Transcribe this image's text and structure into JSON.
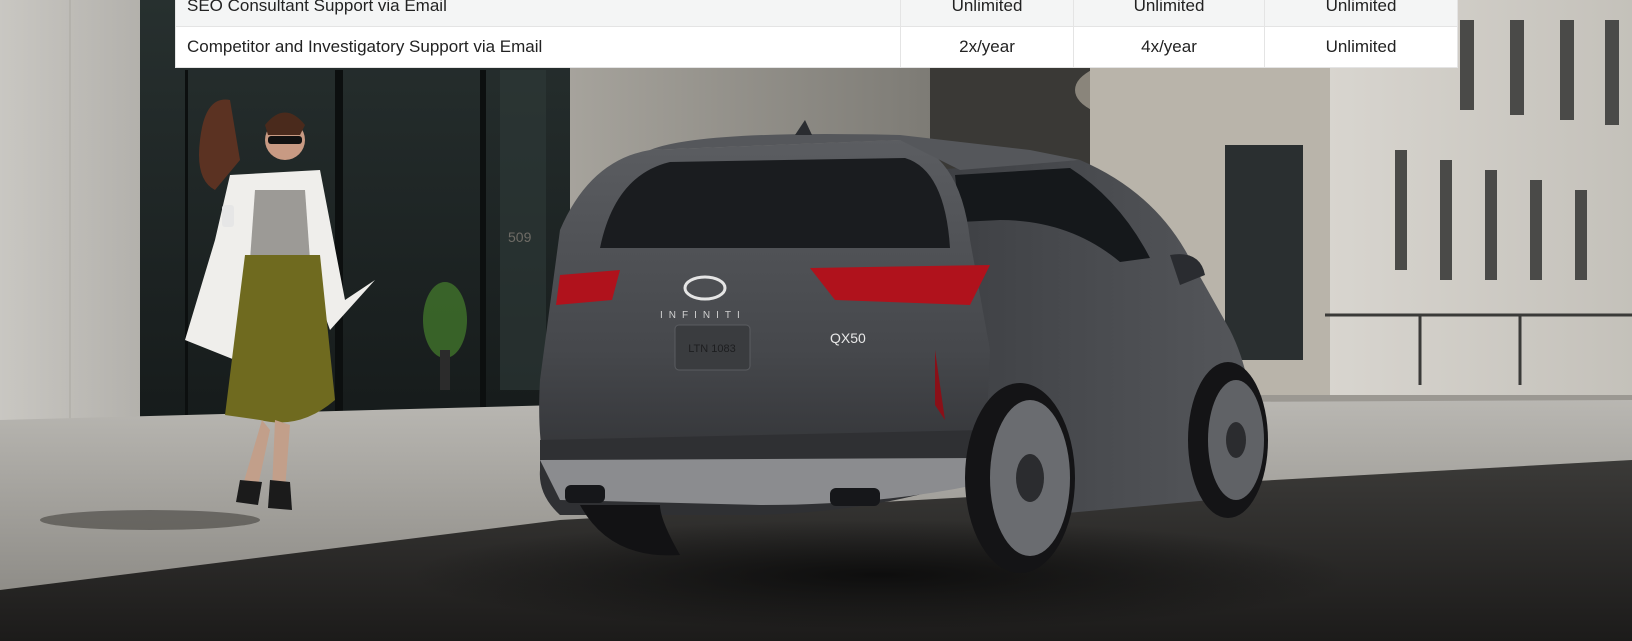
{
  "features_table": {
    "rows": [
      {
        "feature": "SEO Consultant Support via Email",
        "values": [
          "Unlimited",
          "Unlimited",
          "Unlimited"
        ]
      },
      {
        "feature": "Competitor and Investigatory Support via Email",
        "values": [
          "2x/year",
          "4x/year",
          "Unlimited"
        ]
      }
    ]
  },
  "hero": {
    "badge_text": "QX50",
    "plate_text": "LTN 1083",
    "wall_number": "509"
  },
  "colors": {
    "table_row_alt": "#f4f5f5",
    "table_border": "#e4e4e4",
    "text": "#222222",
    "car_body": "#4a4c50",
    "tail_light": "#b0121c"
  }
}
